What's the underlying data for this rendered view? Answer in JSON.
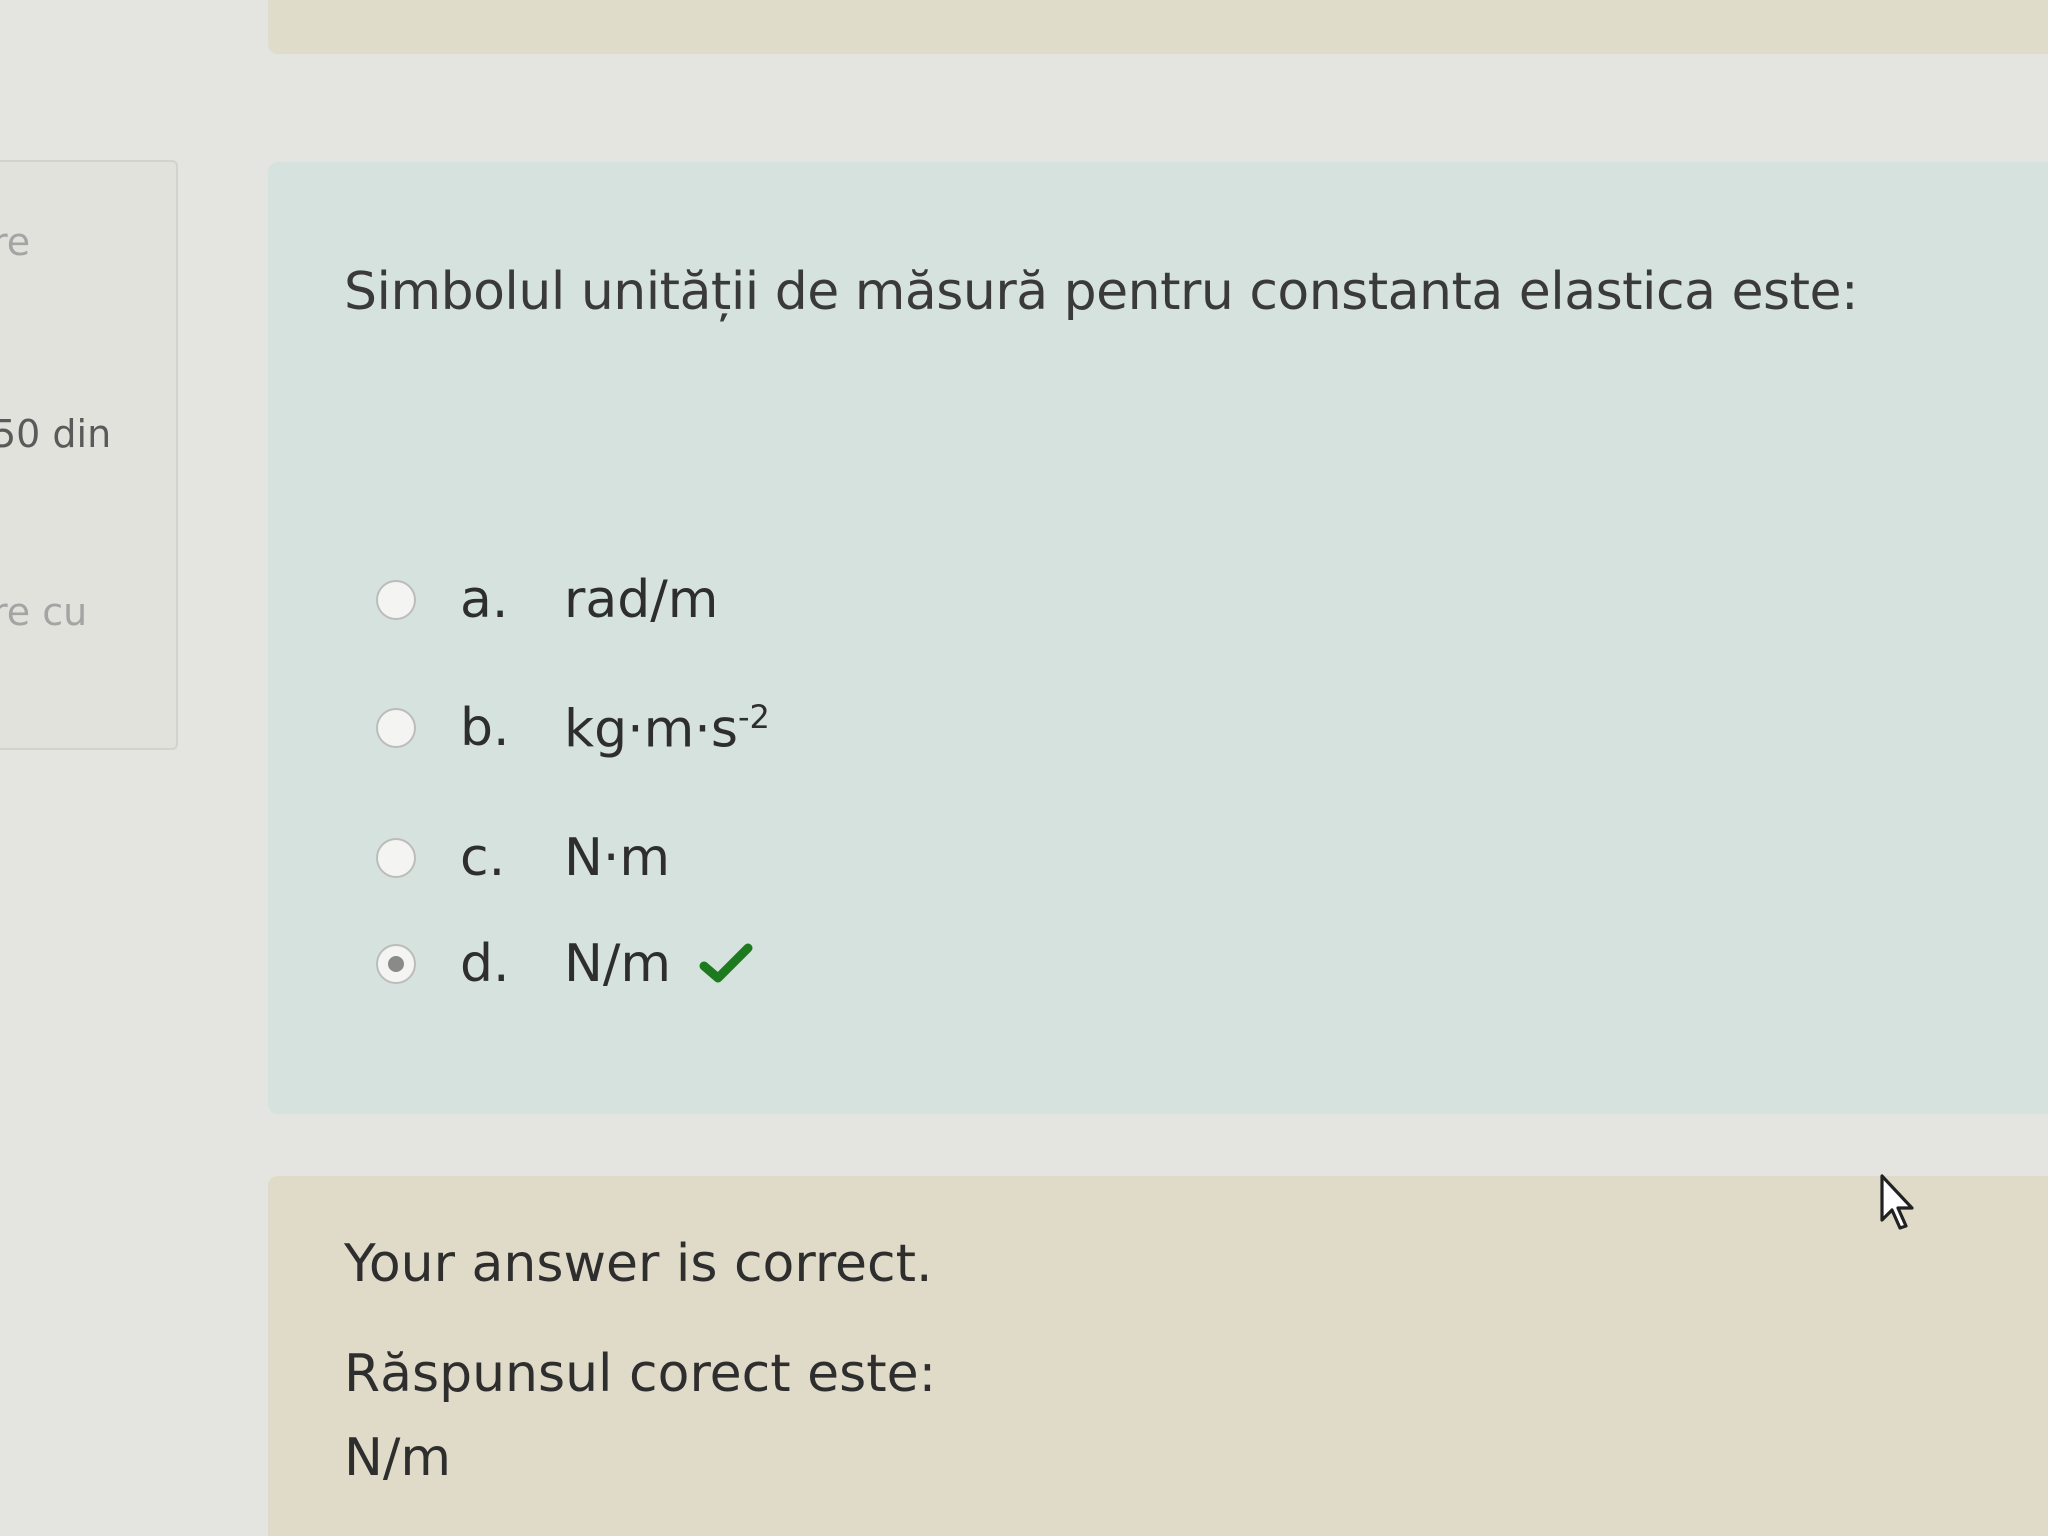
{
  "sidebar": {
    "label_top": "re",
    "question_count": "50 din",
    "label_bottom": "re cu"
  },
  "question": {
    "text": "Simbolul unității de măsură  pentru  constanta elastica este:",
    "options": [
      {
        "letter": "a.",
        "answer": "rad/m",
        "selected": false
      },
      {
        "letter": "b.",
        "answer_base": "kg·m·s",
        "answer_exponent": "-2",
        "selected": false
      },
      {
        "letter": "c.",
        "answer": "N·m",
        "selected": false
      },
      {
        "letter": "d.",
        "answer": "N/m",
        "selected": true
      }
    ],
    "correct_icon": "checkmark-icon",
    "check_color": "#1e7a1e"
  },
  "feedback": {
    "result": "Your answer is correct.",
    "correct_label": "Răspunsul corect este:",
    "correct_answer": "N/m"
  }
}
